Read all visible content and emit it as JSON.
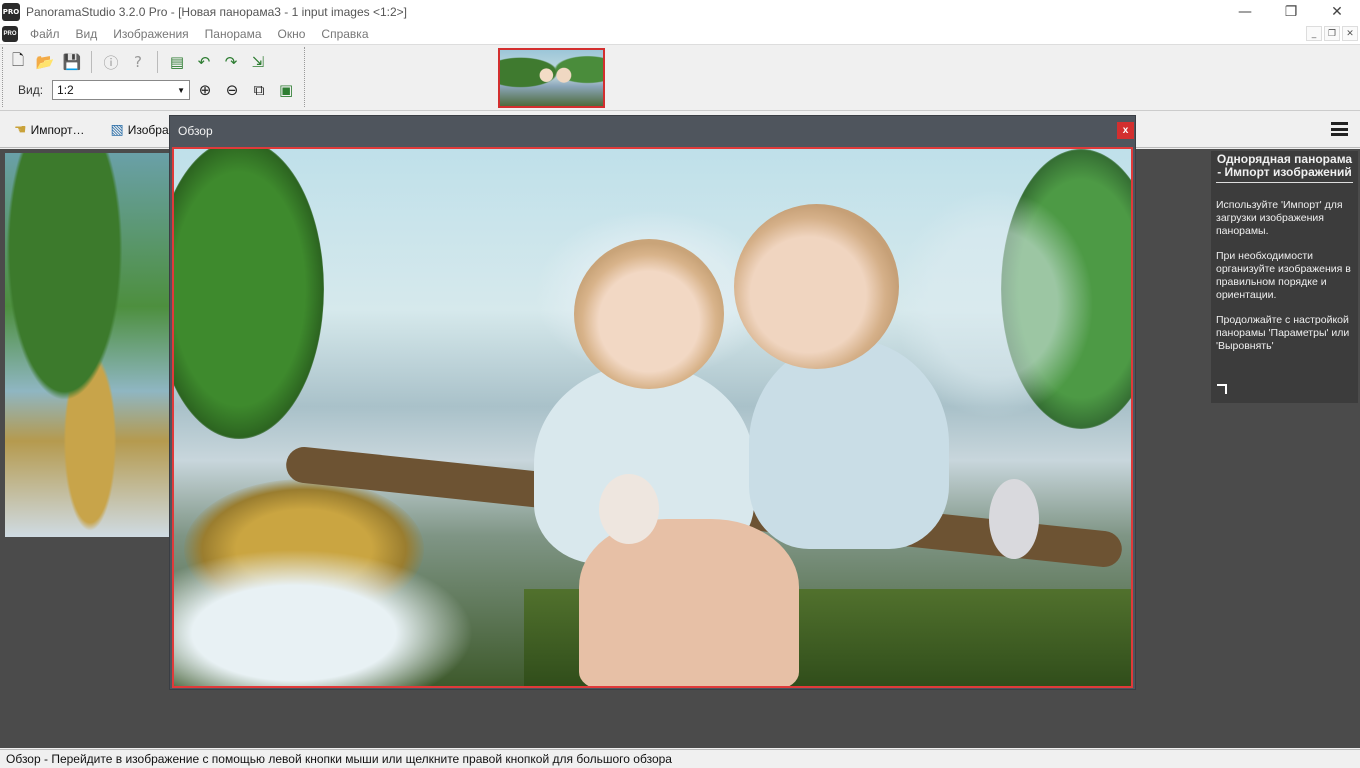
{
  "window": {
    "title": "PanoramaStudio 3.2.0 Pro - [Новая панорама3 - 1 input images <1:2>]",
    "app_icon_text": "PRO",
    "controls": {
      "minimize": "—",
      "restore": "❐",
      "close": "✕"
    }
  },
  "menu": {
    "items": [
      "Файл",
      "Вид",
      "Изображения",
      "Панорама",
      "Окно",
      "Справка"
    ],
    "mdi_controls": {
      "minimize": "_",
      "restore": "❐",
      "close": "✕"
    }
  },
  "toolbar": {
    "view_label": "Вид:",
    "view_value": "1:2"
  },
  "toolbar2": {
    "import_label": "Импорт…",
    "images_label": "Изобра"
  },
  "dialog": {
    "title": "Обзор",
    "close_label": "x"
  },
  "info_panel": {
    "title": "Однорядная панорама - Импорт изображений",
    "paragraphs": [
      "Используйте 'Импорт' для загрузки изображения панорамы.",
      "При необходимости организуйте изображения в правильном порядке и ориентации.",
      "Продолжайте с настройкой панорамы 'Параметры' или 'Выровнять'"
    ]
  },
  "status": {
    "text": "Обзор - Перейдите в изображение с помощью левой кнопки мыши или щелкните правой кнопкой для большого обзора"
  },
  "colors": {
    "accent_red": "#d32f2f",
    "dialog_bg": "#4f555d",
    "workspace_bg": "#4b4b4b",
    "info_bg": "#3c3c3c"
  }
}
